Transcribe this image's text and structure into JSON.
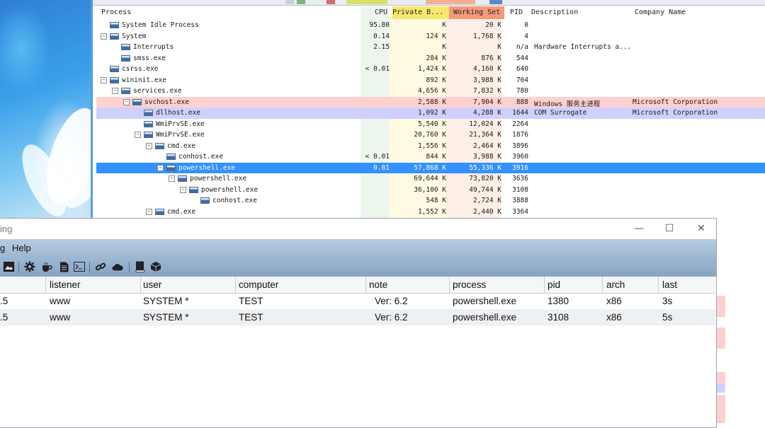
{
  "process_explorer": {
    "headers": {
      "process": "Process",
      "cpu": "CPU",
      "private_bytes": "Private B...",
      "working_set": "Working Set",
      "pid": "PID",
      "description": "Description",
      "company": "Company Name"
    },
    "rows": [
      {
        "name": "System Idle Process",
        "indent": 0,
        "expander": "",
        "cpu": "95.80",
        "priv": "K",
        "ws": "20 K",
        "pid": "0",
        "desc": "",
        "company": "",
        "highlight": ""
      },
      {
        "name": "System",
        "indent": 0,
        "expander": "−",
        "cpu": "0.14",
        "priv": "124 K",
        "ws": "1,768 K",
        "pid": "4",
        "desc": "",
        "company": "",
        "highlight": ""
      },
      {
        "name": "Interrupts",
        "indent": 1,
        "expander": "",
        "cpu": "2.15",
        "priv": "K",
        "ws": "K",
        "pid": "n/a",
        "desc": "Hardware Interrupts a...",
        "company": "",
        "highlight": ""
      },
      {
        "name": "smss.exe",
        "indent": 1,
        "expander": "",
        "cpu": "",
        "priv": "284 K",
        "ws": "876 K",
        "pid": "544",
        "desc": "",
        "company": "",
        "highlight": ""
      },
      {
        "name": "csrss.exe",
        "indent": 0,
        "expander": "",
        "cpu": "< 0.01",
        "priv": "1,424 K",
        "ws": "4,160 K",
        "pid": "640",
        "desc": "",
        "company": "",
        "highlight": ""
      },
      {
        "name": "wininit.exe",
        "indent": 0,
        "expander": "−",
        "cpu": "",
        "priv": "892 K",
        "ws": "3,988 K",
        "pid": "704",
        "desc": "",
        "company": "",
        "highlight": ""
      },
      {
        "name": "services.exe",
        "indent": 1,
        "expander": "−",
        "cpu": "",
        "priv": "4,656 K",
        "ws": "7,832 K",
        "pid": "780",
        "desc": "",
        "company": "",
        "highlight": ""
      },
      {
        "name": "svchost.exe",
        "indent": 2,
        "expander": "−",
        "cpu": "",
        "priv": "2,588 K",
        "ws": "7,904 K",
        "pid": "888",
        "desc": "Windows 服务主进程",
        "company": "Microsoft Corporation",
        "highlight": "pink"
      },
      {
        "name": "dllhost.exe",
        "indent": 3,
        "expander": "",
        "cpu": "",
        "priv": "1,092 K",
        "ws": "4,288 K",
        "pid": "1644",
        "desc": "COM Surrogate",
        "company": "Microsoft Corporation",
        "highlight": "lavender"
      },
      {
        "name": "WmiPrvSE.exe",
        "indent": 3,
        "expander": "",
        "cpu": "",
        "priv": "5,540 K",
        "ws": "12,024 K",
        "pid": "2264",
        "desc": "",
        "company": "",
        "highlight": ""
      },
      {
        "name": "WmiPrvSE.exe",
        "indent": 3,
        "expander": "−",
        "cpu": "",
        "priv": "20,760 K",
        "ws": "21,364 K",
        "pid": "1876",
        "desc": "",
        "company": "",
        "highlight": ""
      },
      {
        "name": "cmd.exe",
        "indent": 4,
        "expander": "−",
        "cpu": "",
        "priv": "1,556 K",
        "ws": "2,464 K",
        "pid": "3896",
        "desc": "",
        "company": "",
        "highlight": ""
      },
      {
        "name": "conhost.exe",
        "indent": 5,
        "expander": "",
        "cpu": "< 0.01",
        "priv": "844 K",
        "ws": "3,988 K",
        "pid": "3960",
        "desc": "",
        "company": "",
        "highlight": ""
      },
      {
        "name": "powershell.exe",
        "indent": 5,
        "expander": "−",
        "cpu": "0.01",
        "priv": "57,868 K",
        "ws": "55,336 K",
        "pid": "3916",
        "desc": "",
        "company": "",
        "highlight": "selected"
      },
      {
        "name": "powershell.exe",
        "indent": 6,
        "expander": "−",
        "cpu": "",
        "priv": "69,644 K",
        "ws": "73,820 K",
        "pid": "3636",
        "desc": "",
        "company": "",
        "highlight": ""
      },
      {
        "name": "powershell.exe",
        "indent": 7,
        "expander": "−",
        "cpu": "",
        "priv": "36,100 K",
        "ws": "49,744 K",
        "pid": "3108",
        "desc": "",
        "company": "",
        "highlight": ""
      },
      {
        "name": "conhost.exe",
        "indent": 8,
        "expander": "",
        "cpu": "",
        "priv": "548 K",
        "ws": "2,724 K",
        "pid": "3888",
        "desc": "",
        "company": "",
        "highlight": ""
      },
      {
        "name": "cmd.exe",
        "indent": 4,
        "expander": "−",
        "cpu": "",
        "priv": "1,552 K",
        "ws": "2,440 K",
        "pid": "3364",
        "desc": "",
        "company": "",
        "highlight": ""
      }
    ]
  },
  "cs_window": {
    "title_fragment": "ing",
    "menu_help_fragment": "g",
    "menu_help": "Help",
    "controls": {
      "minimize": "—",
      "maximize": "☐",
      "close": "✕"
    },
    "columns": {
      "listener": "listener",
      "user": "user",
      "computer": "computer",
      "note": "note",
      "process": "process",
      "pid": "pid",
      "arch": "arch",
      "last": "last"
    },
    "sessions": [
      {
        "ip_fragment": ".5",
        "listener": "www",
        "user": "SYSTEM *",
        "computer": "TEST",
        "note": "Ver: 6.2",
        "process": "powershell.exe",
        "pid": "1380",
        "arch": "x86",
        "last": "3s"
      },
      {
        "ip_fragment": ".5",
        "listener": "www",
        "user": "SYSTEM *",
        "computer": "TEST",
        "note": "Ver: 6.2",
        "process": "powershell.exe",
        "pid": "3108",
        "arch": "x86",
        "last": "5s"
      }
    ],
    "toolbar_icons": [
      "screenshot-icon",
      "settings-gear-icon",
      "coffee-cup-icon",
      "document-icon",
      "terminal-icon",
      "link-icon",
      "cloud-icon",
      "book-icon",
      "package-cube-icon"
    ]
  },
  "colors": {
    "selected_row": "#3390ff",
    "service_row": "#ffd0d0",
    "com_row": "#d0d0ff",
    "private_bytes_header": "#f5e86c",
    "working_set_header": "#f49a7a"
  }
}
